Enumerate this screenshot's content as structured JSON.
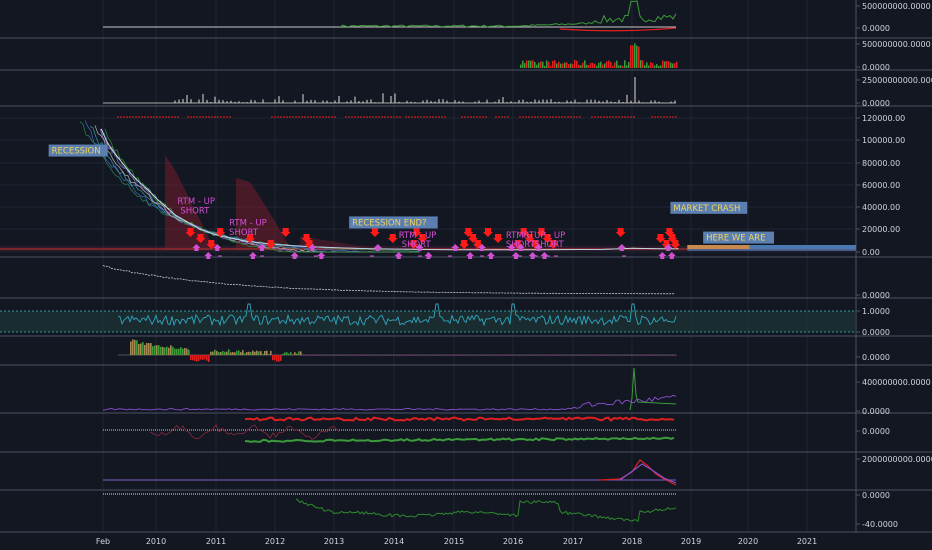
{
  "colors": {
    "background": "#131722",
    "grid": "#1f2533",
    "separator": "#4a5060",
    "axis_text": "#d1d4dc",
    "price_line": "#e8e8e8",
    "down_arrow": "#ff1a1a",
    "up_arrow": "#d14fd1",
    "annotation_bg": "#5b7fb0",
    "annotation_text": "#f0d35a",
    "rtm_text": "#d34fd6",
    "projection_orange": "#c7894c",
    "projection_blue": "#4a78b0",
    "dot_red": "#d21c1c",
    "teal": "#2a9d9a",
    "green": "#3c9c3c",
    "red": "#e02020",
    "purple": "#8a4fd0"
  },
  "chart_data": {
    "type": "line",
    "x_axis_labels": [
      "Feb",
      "2010",
      "2011",
      "2012",
      "2013",
      "2014",
      "2015",
      "2016",
      "2017",
      "2018",
      "2019",
      "2020",
      "2021"
    ],
    "panes": [
      {
        "id": "volume-usd",
        "y_ticks": [
          "500000000.0000",
          "0.0000"
        ]
      },
      {
        "id": "volume-bars",
        "y_ticks": [
          "500000000.0000",
          "0.0000"
        ]
      },
      {
        "id": "big-volume",
        "y_ticks": [
          "25000000000.0000",
          "0.0000"
        ]
      },
      {
        "id": "price",
        "y_ticks": [
          "120000.00",
          "100000.00",
          "80000.00",
          "60000.00",
          "40000.00",
          "20000.00",
          "0.00"
        ],
        "ylim": [
          -5000,
          125000
        ],
        "series": [
          {
            "x": [
              2009.05,
              2009.15,
              2009.25,
              2009.4,
              2009.55,
              2009.7,
              2009.85,
              2010.0,
              2010.15,
              2010.3,
              2010.5,
              2010.7,
              2010.9,
              2011.1,
              2011.3,
              2011.5,
              2011.7,
              2011.9,
              2012.2,
              2012.5,
              2012.8,
              2013.2,
              2013.6,
              2014.0,
              2014.5,
              2015.0,
              2015.5,
              2016.0,
              2016.5,
              2017.0,
              2017.5,
              2018.0,
              2018.5,
              2018.75
            ],
            "y": [
              110000,
              98000,
              90000,
              80000,
              70000,
              62000,
              55000,
              47000,
              40000,
              33000,
              27000,
              21000,
              17000,
              14000,
              12000,
              10000,
              8500,
              7500,
              6200,
              5200,
              4500,
              3800,
              3300,
              2900,
              2600,
              2400,
              2300,
              2300,
              2400,
              2600,
              2700,
              3600,
              3300,
              3200
            ]
          }
        ],
        "annotations": [
          {
            "text": "RECESSION",
            "x": 2008.2,
            "y": 88000,
            "style": "box"
          },
          {
            "text": "RTM - UP",
            "x": 2010.33,
            "y": 43000,
            "style": "text"
          },
          {
            "text": "SHORT",
            "x": 2010.38,
            "y": 34500,
            "style": "text"
          },
          {
            "text": "RTM - UP",
            "x": 2011.2,
            "y": 24000,
            "style": "text"
          },
          {
            "text": "SHORT",
            "x": 2011.2,
            "y": 15500,
            "style": "text"
          },
          {
            "text": "RECESSION END?",
            "x": 2013.25,
            "y": 24000,
            "style": "box"
          },
          {
            "text": "RTM - UP",
            "x": 2014.05,
            "y": 13000,
            "style": "text"
          },
          {
            "text": "SHORT",
            "x": 2014.1,
            "y": 5000,
            "style": "text"
          },
          {
            "text": "RTMRTUP - UP",
            "x": 2015.85,
            "y": 13000,
            "style": "text"
          },
          {
            "text": "SHORTSHORT",
            "x": 2015.85,
            "y": 5000,
            "style": "text"
          },
          {
            "text": "MARKET CRASH",
            "x": 2018.65,
            "y": 37000,
            "style": "box"
          },
          {
            "text": "HERE WE ARE",
            "x": 2019.2,
            "y": 10500,
            "style": "box"
          }
        ],
        "down_arrows_x": [
          2010.55,
          2010.72,
          2010.9,
          2011.05,
          2011.55,
          2011.9,
          2012.15,
          2012.5,
          2012.55,
          2013.65,
          2013.95,
          2014.3,
          2014.35,
          2014.45,
          2015.15,
          2015.22,
          2015.3,
          2015.38,
          2015.55,
          2015.72,
          2016.05,
          2016.15,
          2016.25,
          2016.35,
          2016.45,
          2016.55,
          2016.65,
          2017.78,
          2018.45,
          2018.55,
          2018.6,
          2018.65,
          2018.7
        ],
        "up_arrows_x": [
          2010.65,
          2010.85,
          2011.0,
          2011.6,
          2011.75,
          2012.3,
          2012.6,
          2012.75,
          2013.7,
          2014.05,
          2014.4,
          2014.55,
          2015.0,
          2015.25,
          2015.45,
          2015.6,
          2015.95,
          2016.02,
          2016.1,
          2016.3,
          2016.4,
          2016.5,
          2017.8,
          2018.48,
          2018.58,
          2018.64
        ],
        "projection": {
          "orange": [
            2018.9,
            2019.95
          ],
          "blue": [
            2019.95,
            2021.85
          ]
        }
      },
      {
        "id": "decay-indicator",
        "y_ticks": [
          "0.0000"
        ]
      },
      {
        "id": "oscillator",
        "y_ticks": [
          "1.0000",
          "0.0000"
        ]
      },
      {
        "id": "histogram",
        "y_ticks": [
          "0.0000"
        ]
      },
      {
        "id": "volume-line",
        "y_ticks": [
          "400000000.0000",
          "0.0000"
        ]
      },
      {
        "id": "rg-lines",
        "y_ticks": [
          "0.0000"
        ]
      },
      {
        "id": "spike-line",
        "y_ticks": [
          "2000000000.0000",
          "0.0000"
        ]
      },
      {
        "id": "green-drawdown",
        "y_ticks": [
          "0.0000",
          "-40.0000"
        ]
      }
    ]
  }
}
